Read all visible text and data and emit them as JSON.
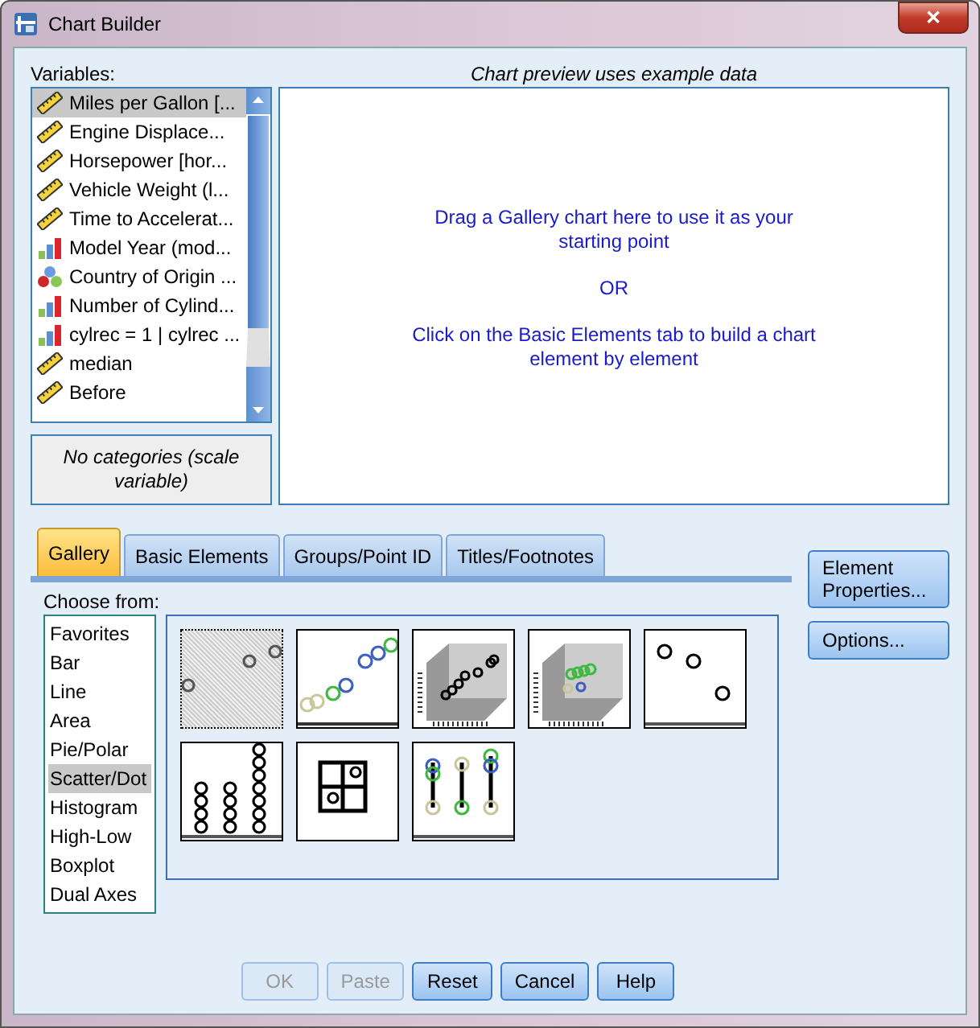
{
  "window": {
    "title": "Chart Builder",
    "close": "✕"
  },
  "variables": {
    "label": "Variables:",
    "items": [
      {
        "name": "Miles per Gallon [...",
        "kind": "scale",
        "selected": true
      },
      {
        "name": "Engine Displace...",
        "kind": "scale",
        "selected": false
      },
      {
        "name": "Horsepower [hor...",
        "kind": "scale",
        "selected": false
      },
      {
        "name": "Vehicle Weight (l...",
        "kind": "scale",
        "selected": false
      },
      {
        "name": "Time to Accelerat...",
        "kind": "scale",
        "selected": false
      },
      {
        "name": "Model Year (mod...",
        "kind": "ordinal",
        "selected": false
      },
      {
        "name": "Country of Origin ...",
        "kind": "nominal",
        "selected": false
      },
      {
        "name": "Number of Cylind...",
        "kind": "ordinal",
        "selected": false
      },
      {
        "name": "cylrec = 1 | cylrec ...",
        "kind": "ordinal",
        "selected": false
      },
      {
        "name": "median",
        "kind": "scale",
        "selected": false
      },
      {
        "name": "Before",
        "kind": "scale",
        "selected": false
      }
    ],
    "categories_note": "No categories (scale variable)"
  },
  "preview": {
    "caption": "Chart preview uses example data",
    "lines": [
      "Drag a Gallery chart here to use it as your starting point",
      "OR",
      "Click on the Basic Elements tab to build a chart element by element"
    ]
  },
  "tabs": [
    {
      "label": "Gallery",
      "selected": true
    },
    {
      "label": "Basic Elements",
      "selected": false
    },
    {
      "label": "Groups/Point ID",
      "selected": false
    },
    {
      "label": "Titles/Footnotes",
      "selected": false
    }
  ],
  "gallery": {
    "label": "Choose from:",
    "types": [
      {
        "label": "Favorites",
        "selected": false
      },
      {
        "label": "Bar",
        "selected": false
      },
      {
        "label": "Line",
        "selected": false
      },
      {
        "label": "Area",
        "selected": false
      },
      {
        "label": "Pie/Polar",
        "selected": false
      },
      {
        "label": "Scatter/Dot",
        "selected": true
      },
      {
        "label": "Histogram",
        "selected": false
      },
      {
        "label": "High-Low",
        "selected": false
      },
      {
        "label": "Boxplot",
        "selected": false
      },
      {
        "label": "Dual Axes",
        "selected": false
      }
    ],
    "thumbnails": [
      {
        "kind": "simple-scatter",
        "dragging": true
      },
      {
        "kind": "grouped-scatter",
        "dragging": false
      },
      {
        "kind": "scatter-3d",
        "dragging": false
      },
      {
        "kind": "grouped-3d",
        "dragging": false
      },
      {
        "kind": "dot-plot",
        "dragging": false
      },
      {
        "kind": "dot-stack",
        "dragging": false
      },
      {
        "kind": "matrix",
        "dragging": false
      },
      {
        "kind": "drop-line",
        "dragging": false
      }
    ]
  },
  "side_buttons": [
    "Element Properties...",
    "Options..."
  ],
  "buttons": [
    {
      "label": "OK",
      "disabled": true
    },
    {
      "label": "Paste",
      "disabled": true
    },
    {
      "label": "Reset",
      "disabled": false
    },
    {
      "label": "Cancel",
      "disabled": false
    },
    {
      "label": "Help",
      "disabled": false
    }
  ]
}
